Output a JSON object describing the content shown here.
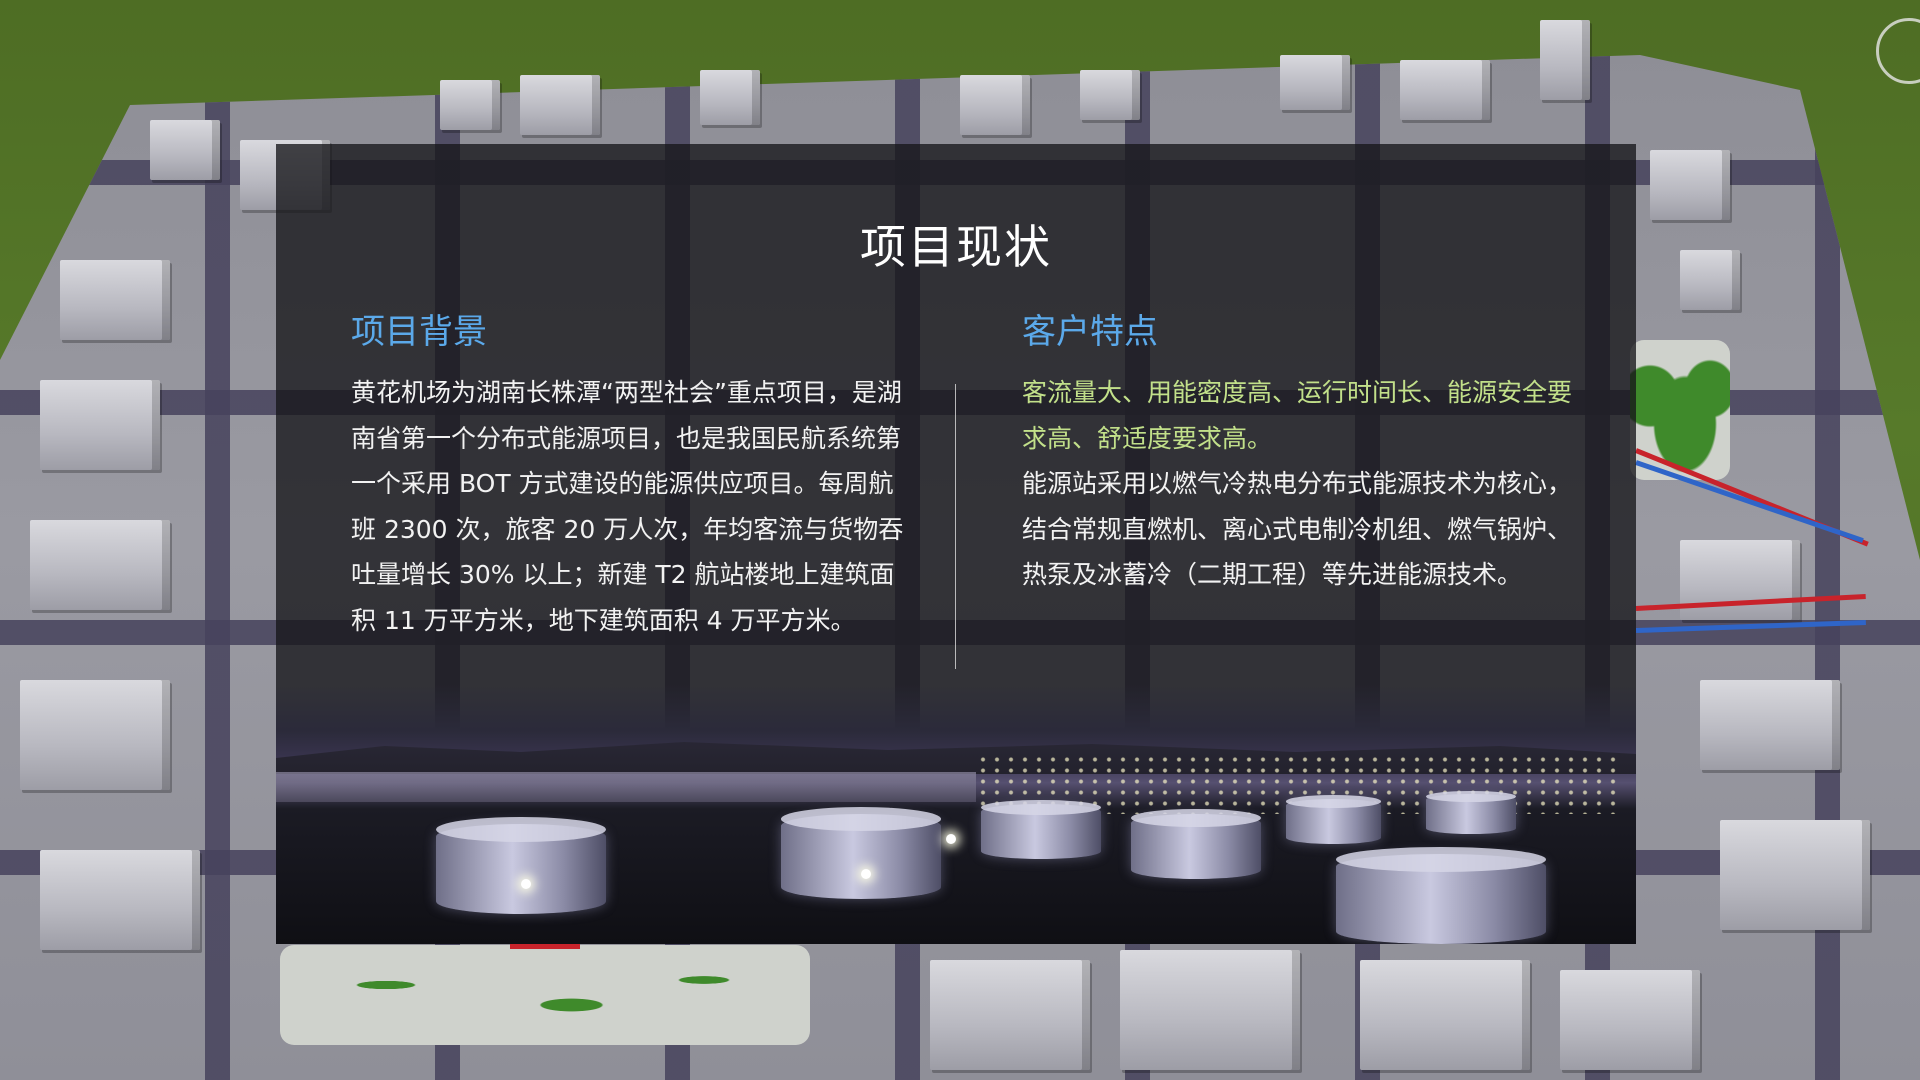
{
  "slide": {
    "title": "项目现状",
    "left": {
      "heading": "项目背景",
      "body": "黄花机场为湖南长株潭“两型社会”重点项目，是湖南省第一个分布式能源项目，也是我国民航系统第一个采用 BOT 方式建设的能源供应项目。每周航班 2300 次，旅客 20 万人次，年均客流与货物吞吐量增长 30% 以上；新建 T2 航站楼地上建筑面积 11 万平方米，地下建筑面积 4 万平方米。"
    },
    "right": {
      "heading": "客户特点",
      "highlight": "客流量大、用能密度高、运行时间长、能源安全要求高、舒适度要求高。",
      "body": "能源站采用以燃气冷热电分布式能源技术为核心，结合常规直燃机、离心式电制冷机组、燃气锅炉、热泵及冰蓄冷（二期工程）等先进能源技术。"
    }
  },
  "colors": {
    "heading_blue": "#5ba9ea",
    "highlight_green": "#c2e08a",
    "panel_bg": "rgba(22,22,26,0.78)"
  },
  "icons": [
    "compass-icon"
  ]
}
